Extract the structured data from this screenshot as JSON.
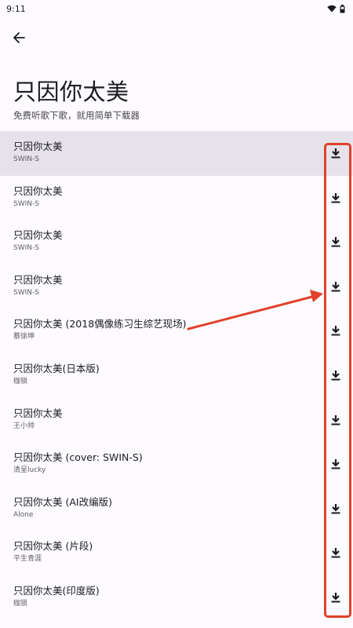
{
  "status_bar": {
    "time": "9:11"
  },
  "header": {
    "back_icon": "arrow-left-icon",
    "title": "只因你太美",
    "subtitle": "免费听歌下歌，就用简单下载器"
  },
  "songs": [
    {
      "title": "只因你太美",
      "artist": "SWIN-S"
    },
    {
      "title": "只因你太美",
      "artist": "SWIN-S"
    },
    {
      "title": "只因你太美",
      "artist": "SWIN-S"
    },
    {
      "title": "只因你太美",
      "artist": "SWIN-S"
    },
    {
      "title": "只因你太美 (2018偶像练习生综艺现场)",
      "artist": "蔡徐坤"
    },
    {
      "title": "只因你太美(日本版)",
      "artist": "枷锁"
    },
    {
      "title": "只因你太美",
      "artist": "王小帅"
    },
    {
      "title": "只因你太美 (cover: SWIN-S)",
      "artist": "清呈lucky"
    },
    {
      "title": "只因你太美 (AI改编版)",
      "artist": "Alone"
    },
    {
      "title": "只因你太美 (片段)",
      "artist": "平生青涯"
    },
    {
      "title": "只因你太美(印度版)",
      "artist": "枷锁"
    }
  ],
  "icons": {
    "download": "download-icon",
    "wifi": "wifi-icon",
    "battery": "battery-icon"
  },
  "colors": {
    "background": "#fdfbff",
    "selected_row": "#e6e2ea",
    "annotation": "#e2402b"
  }
}
